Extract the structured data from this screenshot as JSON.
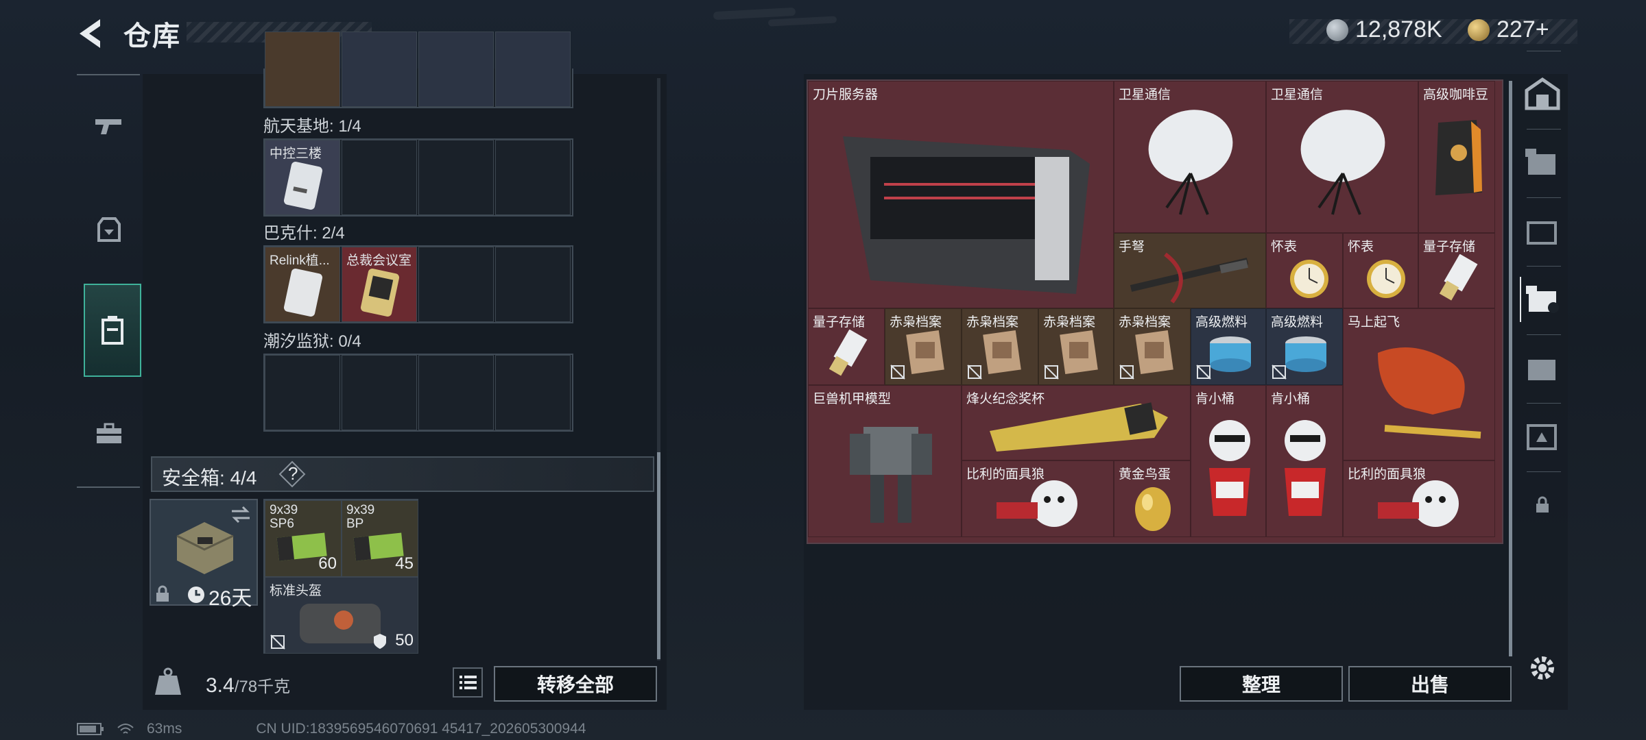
{
  "header": {
    "title": "仓库",
    "currency1": "12,878K",
    "currency2": "227+"
  },
  "left_tabs": [
    "weapon-tab",
    "gear-tab",
    "stash-tab",
    "tools-tab"
  ],
  "keycards": {
    "groups": [
      {
        "title": "航天基地: 1/4",
        "items": [
          "中控三楼"
        ]
      },
      {
        "title": "巴克什: 2/4",
        "items": [
          "Relink植...",
          "总裁会议室"
        ]
      },
      {
        "title": "潮汐监狱: 0/4",
        "items": []
      }
    ]
  },
  "safe_box": {
    "title": "安全箱: 4/4",
    "help": "?",
    "case_days": "26天",
    "items": [
      {
        "label": "9x39\nSP6",
        "count": "60"
      },
      {
        "label": "9x39\nBP",
        "count": "45"
      },
      {
        "label": "标准头盔",
        "count": "50"
      }
    ]
  },
  "footer": {
    "weight": "3.4",
    "weight_max": "/78千克",
    "transfer_all": "转移全部",
    "sort": "整理",
    "sell": "出售"
  },
  "stash_items": [
    {
      "name": "刀片服务器"
    },
    {
      "name": "卫星通信"
    },
    {
      "name": "卫星通信"
    },
    {
      "name": "高级咖啡豆"
    },
    {
      "name": "手弩"
    },
    {
      "name": "怀表"
    },
    {
      "name": "怀表"
    },
    {
      "name": "量子存储"
    },
    {
      "name": "量子存储"
    },
    {
      "name": "赤枭档案"
    },
    {
      "name": "赤枭档案"
    },
    {
      "name": "赤枭档案"
    },
    {
      "name": "赤枭档案"
    },
    {
      "name": "高级燃料"
    },
    {
      "name": "高级燃料"
    },
    {
      "name": "马上起飞"
    },
    {
      "name": "巨兽机甲模型"
    },
    {
      "name": "烽火纪念奖杯"
    },
    {
      "name": "肯小桶"
    },
    {
      "name": "肯小桶"
    },
    {
      "name": "比利的面具狼"
    },
    {
      "name": "黄金鸟蛋"
    },
    {
      "name": "比利的面具狼"
    }
  ],
  "status": {
    "ping": "63ms",
    "uid": "CN UID:1839569546070691 45417_202605300944"
  },
  "colors": {
    "accent": "#3fb29a",
    "stash_red": "#5b2e36",
    "stash_gold": "#4a3a2c",
    "stash_blue": "#2c3444"
  }
}
